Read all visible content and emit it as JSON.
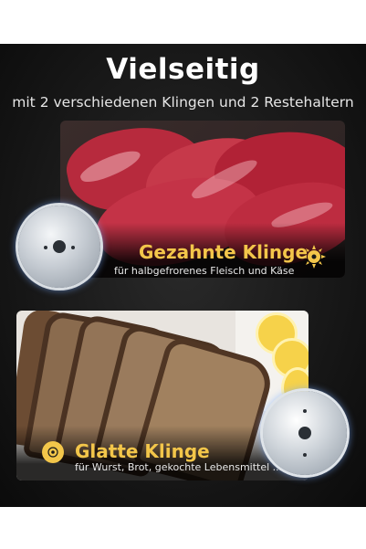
{
  "title": "Vielseitig",
  "subtitle": "mit 2 verschiedenen Klingen und 2 Restehaltern",
  "blades": [
    {
      "name": "Gezahnte Klinge",
      "description": "für halbgefrorenes Fleisch und Käse"
    },
    {
      "name": "Glatte Klinge",
      "description": "für Wurst, Brot, gekochte Lebensmittel ..."
    }
  ],
  "colors": {
    "accent": "#f3c64a",
    "panel": "#161616",
    "text": "#ffffff",
    "meat": "#b3283a",
    "bread": "#7a5a3e"
  },
  "icons": [
    "serrated-blade-icon",
    "smooth-blade-icon"
  ]
}
